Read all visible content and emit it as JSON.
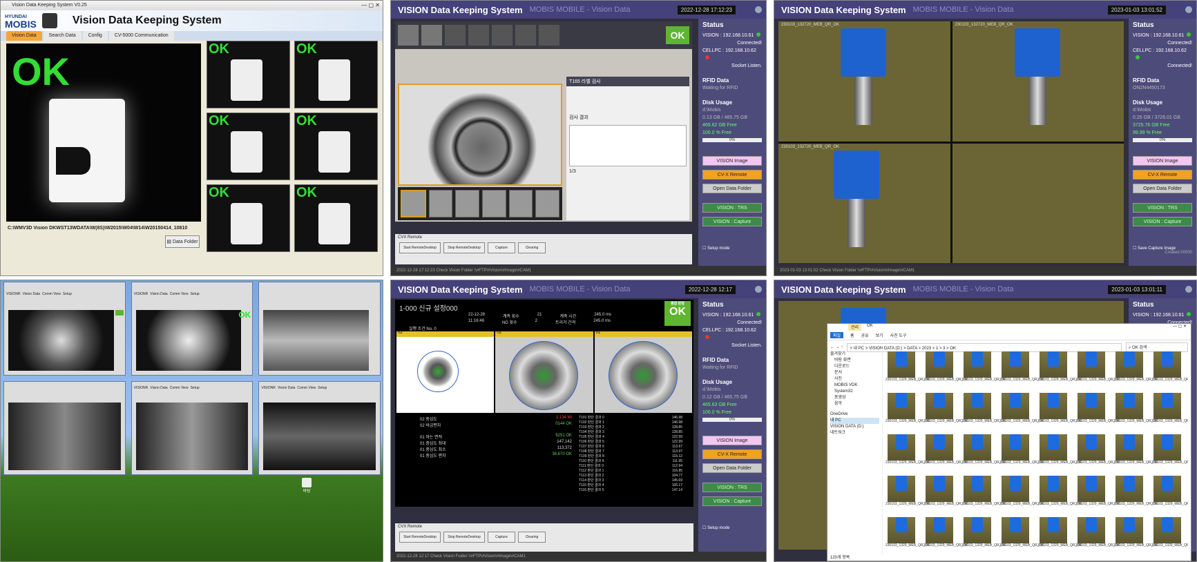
{
  "panel1": {
    "window_title": "Vision Data Keeping System V0.25",
    "logo_top": "HYUNDAI",
    "logo_main": "MOBIS",
    "app_title": "Vision Data Keeping System",
    "tabs": [
      "Vision Data",
      "Search Data",
      "Config",
      "CV-5000 Communication"
    ],
    "main_result": "OK",
    "thumb_result": "OK",
    "path": "C:\\WMV3D Vision DKWST13WDATA\\W(8S)\\W2015\\W04\\W14\\W20150414_10810",
    "data_folder_btn": "Data Folder"
  },
  "panel2": {
    "title": "VISION Data Keeping System",
    "subtitle": "MOBIS MOBILE - Vision Data",
    "time": "2022-12-28 17:12:23",
    "ok": "OK",
    "status": {
      "heading": "Status",
      "vision": "VISION : 192.168.10.61",
      "vision_state": "Connected!",
      "cellpc": "CELLPC : 192.168.10.62",
      "cellpc_state": "Socket Listen.",
      "rfid_label": "RFID Data",
      "rfid_value": "Waiting for RFID",
      "disk_label": "Disk Usage",
      "disk_drive": "d:\\Mobis",
      "disk_used": "0.13 GB / 465.75 GB",
      "disk_free": "465.62 GB Free",
      "disk_pct": "100.0 % Free",
      "bar": "0%"
    },
    "buttons": [
      "VISION Image",
      "CV-X Remote",
      "Open Data Folder",
      "VISION : TRS",
      "VISION : Capture"
    ],
    "setup_mode": "Setup mode",
    "cvx_remote": "CVX Remote",
    "bottom_buttons": [
      "Start RemoteDesktop",
      "Stop RemoteDesktop",
      "Capture",
      "Clearing"
    ],
    "footer": "2022-12-28 17:12:23  Check Vision Folder \\\\#FTP\\#Vision\\#Image\\#CAM1",
    "sub_top": "T165  라벨 검사",
    "sub_label": "검사 결과",
    "page": "1/3"
  },
  "panel3": {
    "title": "VISION Data Keeping System",
    "subtitle": "MOBIS MOBILE - Vision Data",
    "time": "2023-01-03 13:01:52",
    "img_labels": [
      "230103_132720_MEB_QR_OK",
      "230103_132720_MEB_QR_OK",
      "230103_132720_MEB_QR_OK"
    ],
    "status": {
      "heading": "Status",
      "vision": "VISION : 192.168.10.61",
      "vision_state": "Connected!",
      "cellpc": "CELLPC : 192.168.10.62",
      "cellpc_state": "Connected!",
      "rfid_label": "RFID Data",
      "rfid_value": "ON2N4450173",
      "disk_label": "Disk Usage",
      "disk_drive": "d:\\Mobis",
      "disk_used": "0.25 GB / 3726.01 GB",
      "disk_free": "3725.76 GB Free",
      "disk_pct": "99.99 % Free",
      "bar": "0%"
    },
    "buttons": [
      "VISION Image",
      "CV-X Remote",
      "Open Data Folder",
      "VISION : TRS",
      "VISION : Capture"
    ],
    "save_capture": "Save Capture Image",
    "created": "Created 00000",
    "footer": "2023-01-03 13:01:52  Check Vision Folder \\\\#FTP\\#Vision\\#Image\\#CAM1"
  },
  "panel4": {
    "mini_tabs": [
      "VISIONR",
      "Vision Data",
      "Comm View",
      "Setup"
    ],
    "ok": "OK",
    "desktop_icon": "바탕"
  },
  "panel5": {
    "title": "VISION Data Keeping System",
    "subtitle": "MOBIS MOBILE - Vision Data",
    "time": "2022-12-28 12:17",
    "header_left": "1-000  신규 설정000",
    "header_rows": [
      [
        "22-12-28",
        "계측 횟수",
        "21",
        "계측 시간",
        "245.0 ms"
      ],
      [
        "11:16:46",
        "NG 횟수",
        "2",
        "트리거 간격",
        "245.0 ms"
      ]
    ],
    "label_row": "실행 조건  No. 0",
    "ok": "OK",
    "ok_sub": "종합 판정",
    "tiles": [
      "02",
      "02",
      "01"
    ],
    "results_left": [
      [
        "02  중심도",
        "1.134 Mi"
      ],
      [
        "02  바금편차",
        "0144 OK"
      ],
      [
        "",
        ""
      ],
      [
        "01  마는 면적",
        "6251 OK"
      ],
      [
        "01  중심도 최대",
        "147,142"
      ],
      [
        "01  중심도 최소",
        "113,372"
      ],
      [
        "01  중심도 편차",
        "36,670 OK"
      ]
    ],
    "results_right": [
      [
        "T101 판단 결과 0",
        "146.98"
      ],
      [
        "T102 판단 결과 1",
        "146.98"
      ],
      [
        "T103 판단 결과 2",
        "128.85"
      ],
      [
        "T104 판단 결과 3",
        "128.85"
      ],
      [
        "T105 판단 결과 4",
        "122.99"
      ],
      [
        "T106 판단 결과 5",
        "122.99"
      ],
      [
        "T107 판단 결과 6",
        "113.67"
      ],
      [
        "T108 판단 결과 7",
        "113.97"
      ],
      [
        "T109 판단 결과 8",
        "115.12"
      ],
      [
        "T110 판단 결과 9",
        "111.95"
      ],
      [
        "T111 판단 결과 0",
        "112.94"
      ],
      [
        "T112 판단 결과 1",
        "116.85"
      ],
      [
        "T113 판단 결과 2",
        "104.77"
      ],
      [
        "T114 판단 결과 3",
        "145.69"
      ],
      [
        "T115 판단 결과 4",
        "105.17"
      ],
      [
        "T116 판단 결과 5",
        "147.14"
      ]
    ],
    "status": {
      "heading": "Status",
      "vision": "VISION : 192.168.10.61",
      "vision_state": "Connected!",
      "cellpc": "CELLPC : 192.168.10.62",
      "cellpc_state": "Socket Listen.",
      "rfid_label": "RFID Data",
      "rfid_value": "Waiting for RFID",
      "disk_label": "Disk Usage",
      "disk_drive": "d:\\Mobis",
      "disk_used": "0.12 GB / 465.75 GB",
      "disk_free": "465.63 GB Free",
      "disk_pct": "100.0 % Free",
      "bar": "0%"
    },
    "buttons": [
      "VISION Image",
      "CV-X Remote",
      "Open Data Folder",
      "VISION : TRS",
      "VISION : Capture"
    ],
    "setup_mode": "Setup mode",
    "cvx_remote": "CVX Remote",
    "bottom_buttons": [
      "Start RemoteDesktop",
      "Stop RemoteDesktop",
      "Capture",
      "Clearing"
    ],
    "footer": "2022-12-28 12:17  Check Vision Folder \\\\#FTP\\#Vision\\#Image\\#CAM1"
  },
  "panel6": {
    "title": "VISION Data Keeping System",
    "subtitle": "MOBIS MOBILE - Vision Data",
    "time": "2023-01-03 13:01:11",
    "status": {
      "heading": "Status",
      "vision": "VISION : 192.168.10.61",
      "vision_state": "Connected!"
    },
    "explorer": {
      "tabs": [
        "파일",
        "홈",
        "공유",
        "보기",
        "사진 도구"
      ],
      "ok_tab": "OK",
      "manage": "관리",
      "address": "> 내 PC > VISION DATA (D:) > DATA > 2023 > 1 > 3 > OK",
      "search": "OK 검색",
      "tree": [
        "즐겨찾기",
        "바탕 화면",
        "다운로드",
        "문서",
        "사진",
        "MOBIS VDK",
        "System32",
        "동영상",
        "음악",
        "OneDrive",
        "내 PC",
        "VISION DATA (D:)",
        "네트워크"
      ],
      "file_label": "230103_1329_MEB_QR_OK",
      "count": "120개 항목"
    }
  }
}
